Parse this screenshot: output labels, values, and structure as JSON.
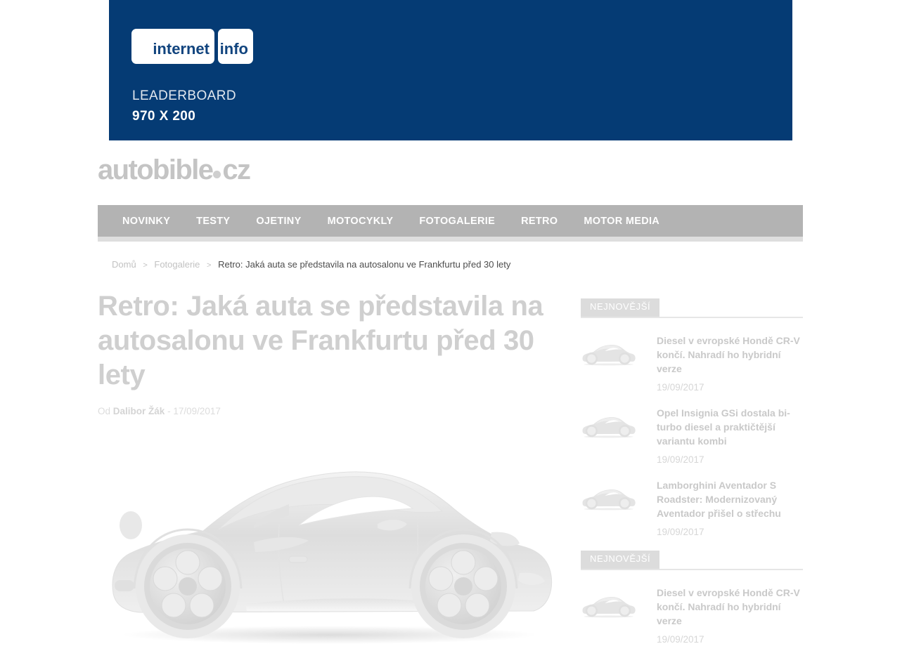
{
  "banner": {
    "logo_box_1": "internet",
    "logo_box_2": "info",
    "slot_name": "LEADERBOARD",
    "slot_size": "970 X 200",
    "bg_color": "#053b74",
    "text_color": "#ffffff"
  },
  "site": {
    "logo_main": "autobible",
    "logo_tld": "cz"
  },
  "nav": {
    "items": [
      {
        "label": "NOVINKY"
      },
      {
        "label": "TESTY"
      },
      {
        "label": "OJETINY"
      },
      {
        "label": "MOTOCYKLY"
      },
      {
        "label": "FOTOGALERIE"
      },
      {
        "label": "RETRO"
      },
      {
        "label": "MOTOR MEDIA"
      }
    ],
    "bg_color": "#b3b3b3"
  },
  "breadcrumb": {
    "home": "Domů",
    "sep1": ">",
    "section": "Fotogalerie",
    "sep2": ">",
    "current": "Retro: Jaká auta se představila na autosalonu ve Frankfurtu před 30 lety"
  },
  "article": {
    "headline": "Retro: Jaká auta se představila na autosalonu ve Frankfurtu před 30 lety",
    "byline_prefix": "Od",
    "author": "Dalibor Žák",
    "byline_sep": "-",
    "date": "17/09/2017",
    "hero_alt": "car-photo"
  },
  "sidebar": {
    "widgets": [
      {
        "title": "NEJNOVĚJŠÍ",
        "posts": [
          {
            "title": "Diesel v evropské Hondě CR-V končí. Nahradí ho hybridní verze",
            "date": "19/09/2017",
            "thumb": "car-thumbnail"
          },
          {
            "title": "Opel Insignia GSi dostala bi-turbo diesel a praktičtější variantu kombi",
            "date": "19/09/2017",
            "thumb": "car-thumbnail"
          },
          {
            "title": "Lamborghini Aventador S Roadster: Modernizovaný Aventador přišel o střechu",
            "date": "19/09/2017",
            "thumb": "car-thumbnail"
          }
        ]
      },
      {
        "title": "NEJNOVĚJŠÍ",
        "posts": [
          {
            "title": "Diesel v evropské Hondě CR-V končí. Nahradí ho hybridní verze",
            "date": "19/09/2017",
            "thumb": "car-thumbnail"
          }
        ]
      }
    ]
  }
}
